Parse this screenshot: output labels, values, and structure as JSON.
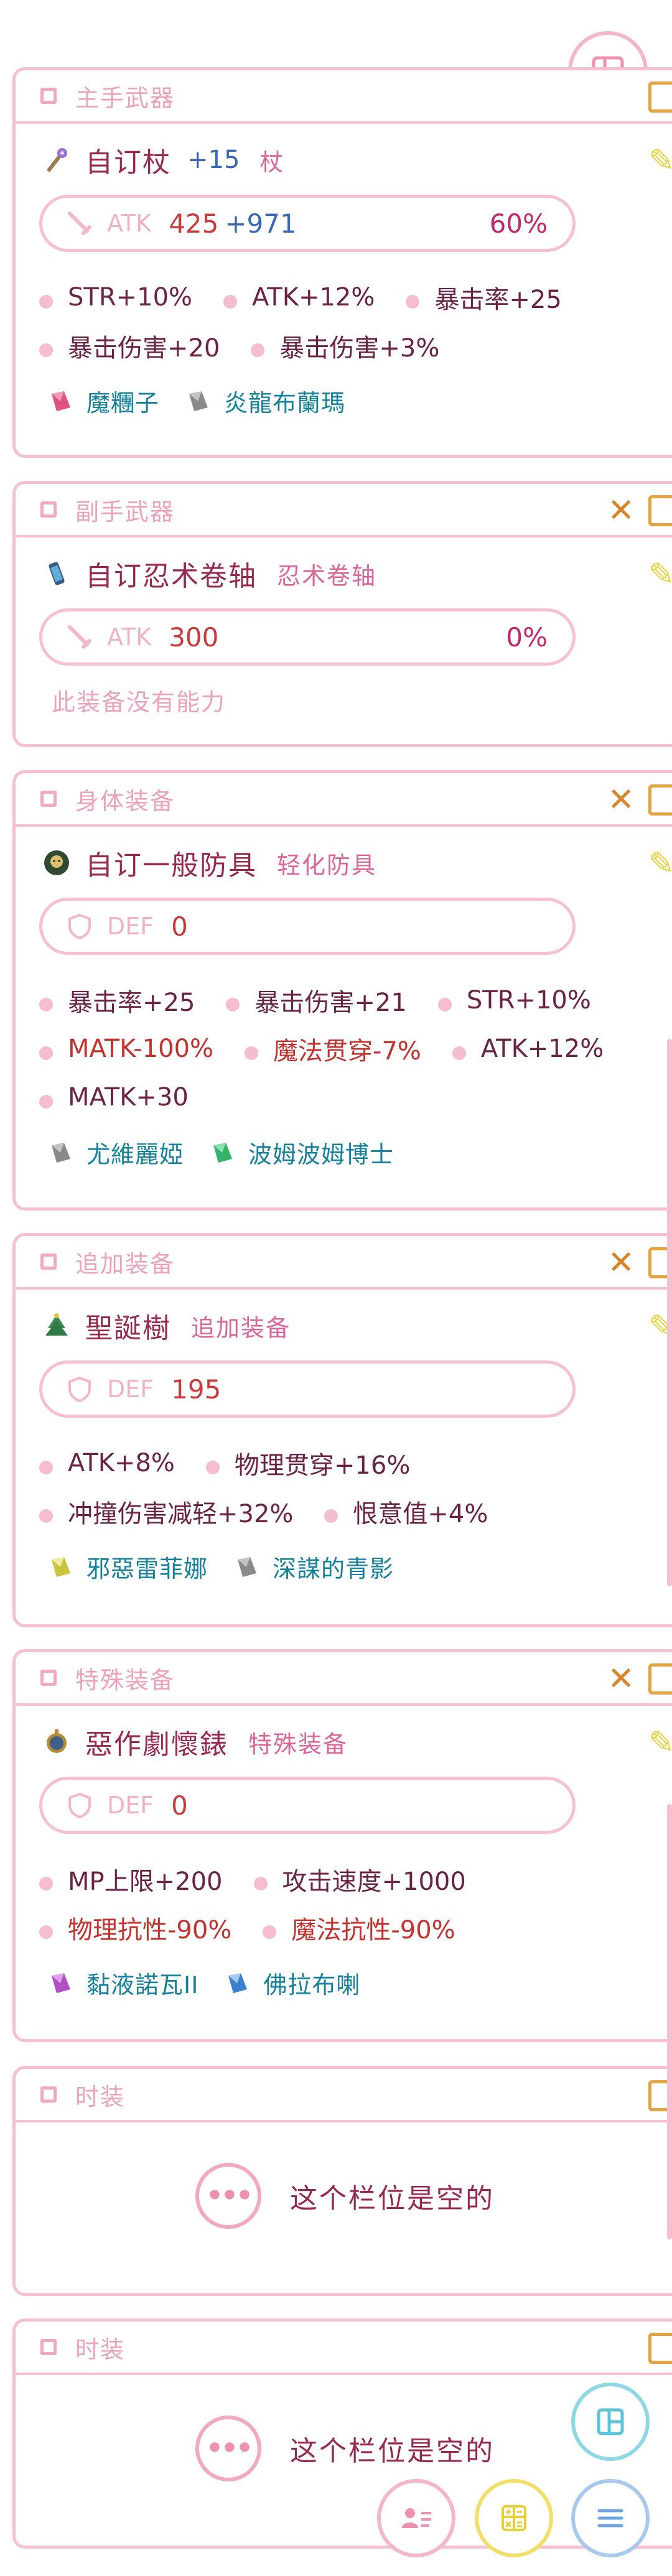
{
  "slots": [
    {
      "header": "主手武器",
      "has_close": false,
      "name": "自订杖",
      "refine": "+15",
      "type": "杖",
      "stat_label": "ATK",
      "stat_value": "425",
      "stat_plus": "+971",
      "stat_pct": "60%",
      "abilities": [
        {
          "text": "STR+10%",
          "neg": false
        },
        {
          "text": "ATK+12%",
          "neg": false
        },
        {
          "text": "暴击率+25",
          "neg": false
        },
        {
          "text": "暴击伤害+20",
          "neg": false
        },
        {
          "text": "暴击伤害+3%",
          "neg": false
        }
      ],
      "crystals": [
        {
          "name": "魔糰子",
          "color": "#e0537f"
        },
        {
          "name": "炎龍布蘭瑪",
          "color": "#8a8a8a"
        }
      ]
    },
    {
      "header": "副手武器",
      "has_close": true,
      "name": "自订忍术卷轴",
      "refine": "",
      "type": "忍术卷轴",
      "stat_label": "ATK",
      "stat_value": "300",
      "stat_plus": "",
      "stat_pct": "0%",
      "no_ability": "此装备没有能力"
    },
    {
      "header": "身体装备",
      "has_close": true,
      "name": "自订一般防具",
      "refine": "",
      "type": "轻化防具",
      "stat_label": "DEF",
      "stat_value": "0",
      "abilities": [
        {
          "text": "暴击率+25",
          "neg": false
        },
        {
          "text": "暴击伤害+21",
          "neg": false
        },
        {
          "text": "STR+10%",
          "neg": false
        },
        {
          "text": "MATK-100%",
          "neg": true
        },
        {
          "text": "魔法贯穿-7%",
          "neg": true
        },
        {
          "text": "ATK+12%",
          "neg": false
        },
        {
          "text": "MATK+30",
          "neg": false
        }
      ],
      "crystals": [
        {
          "name": "尤維麗婭",
          "color": "#8a8a8a"
        },
        {
          "name": "波姆波姆博士",
          "color": "#35b26a"
        }
      ]
    },
    {
      "header": "追加装备",
      "has_close": true,
      "name": "聖誕樹",
      "refine": "",
      "type": "追加装备",
      "stat_label": "DEF",
      "stat_value": "195",
      "abilities": [
        {
          "text": "ATK+8%",
          "neg": false
        },
        {
          "text": "物理贯穿+16%",
          "neg": false
        },
        {
          "text": "冲撞伤害减轻+32%",
          "neg": false
        },
        {
          "text": "恨意值+4%",
          "neg": false
        }
      ],
      "crystals": [
        {
          "name": "邪惡雷菲娜",
          "color": "#c9c43a"
        },
        {
          "name": "深謀的青影",
          "color": "#8a8a8a"
        }
      ]
    },
    {
      "header": "特殊装备",
      "has_close": true,
      "name": "惡作劇懷錶",
      "refine": "",
      "type": "特殊装备",
      "stat_label": "DEF",
      "stat_value": "0",
      "abilities": [
        {
          "text": "MP上限+200",
          "neg": false
        },
        {
          "text": "攻击速度+1000",
          "neg": false
        },
        {
          "text": "物理抗性-90%",
          "neg": true
        },
        {
          "text": "魔法抗性-90%",
          "neg": true
        }
      ],
      "crystals": [
        {
          "name": "黏液諾瓦II",
          "color": "#b14fc4"
        },
        {
          "name": "佛拉布喇",
          "color": "#3c7fcf"
        }
      ]
    }
  ],
  "empty_slots": [
    {
      "header": "时装",
      "text": "这个栏位是空的"
    },
    {
      "header": "时装",
      "text": "这个栏位是空的"
    }
  ],
  "colors": {
    "accent_pink": "#f6c0d2",
    "title_text": "#97294f",
    "crystal_text": "#16819a",
    "negative_text": "#c2322f"
  }
}
